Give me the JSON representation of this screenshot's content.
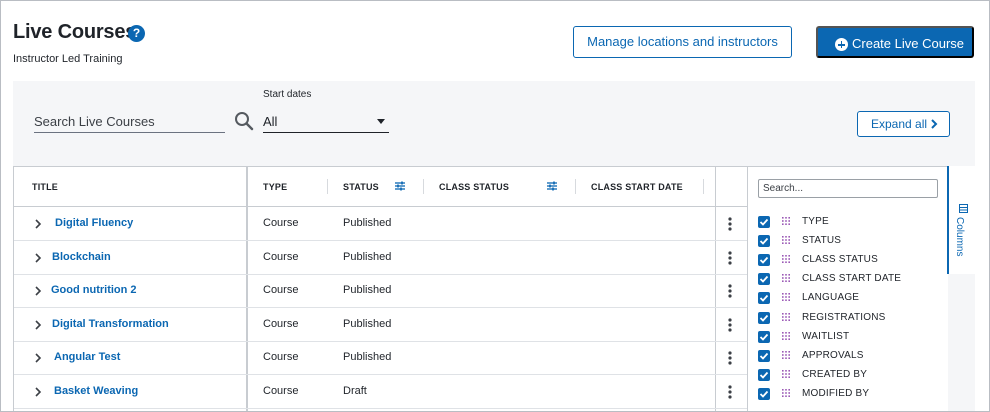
{
  "header": {
    "title": "Live Courses",
    "help_icon": "?",
    "subtitle": "Instructor Led Training",
    "manage_button": "Manage locations and instructors",
    "create_button": "Create Live Course"
  },
  "filters": {
    "search_placeholder": "Search Live Courses",
    "start_dates_label": "Start dates",
    "start_dates_value": "All",
    "expand_all": "Expand all"
  },
  "table": {
    "headers": {
      "title": "TITLE",
      "type": "TYPE",
      "status": "STATUS",
      "class_status": "CLASS STATUS",
      "class_start_date": "CLASS START DATE"
    },
    "rows": [
      {
        "title": "Digital Fluency",
        "type": "Course",
        "status": "Published"
      },
      {
        "title": "Blockchain",
        "type": "Course",
        "status": "Published"
      },
      {
        "title": "Good nutrition 2",
        "type": "Course",
        "status": "Published"
      },
      {
        "title": "Digital Transformation",
        "type": "Course",
        "status": "Published"
      },
      {
        "title": "Angular Test",
        "type": "Course",
        "status": "Published"
      },
      {
        "title": "Basket Weaving",
        "type": "Course",
        "status": "Draft"
      }
    ]
  },
  "columns_panel": {
    "search_placeholder": "Search...",
    "tab_label": "Columns",
    "items": [
      {
        "label": "TYPE",
        "checked": true
      },
      {
        "label": "STATUS",
        "checked": true
      },
      {
        "label": "CLASS STATUS",
        "checked": true
      },
      {
        "label": "CLASS START DATE",
        "checked": true
      },
      {
        "label": "LANGUAGE",
        "checked": true
      },
      {
        "label": "REGISTRATIONS",
        "checked": true
      },
      {
        "label": "WAITLIST",
        "checked": true
      },
      {
        "label": "APPROVALS",
        "checked": true
      },
      {
        "label": "CREATED BY",
        "checked": true
      },
      {
        "label": "MODIFIED BY",
        "checked": true
      }
    ]
  },
  "colors": {
    "accent": "#0b67b2",
    "panel_bg": "#f5f6f8",
    "border": "#c8ccd1"
  },
  "icons": {
    "help": "help-circle-icon",
    "create": "plus-circle-icon",
    "search": "search-icon",
    "dropdown": "caret-down-icon",
    "expand": "chevron-right-icon",
    "row_expand": "chevron-right-icon",
    "row_menu": "more-vertical-icon",
    "header_filter": "filter-sliders-icon",
    "drag": "drag-grip-icon",
    "columns": "columns-icon"
  }
}
